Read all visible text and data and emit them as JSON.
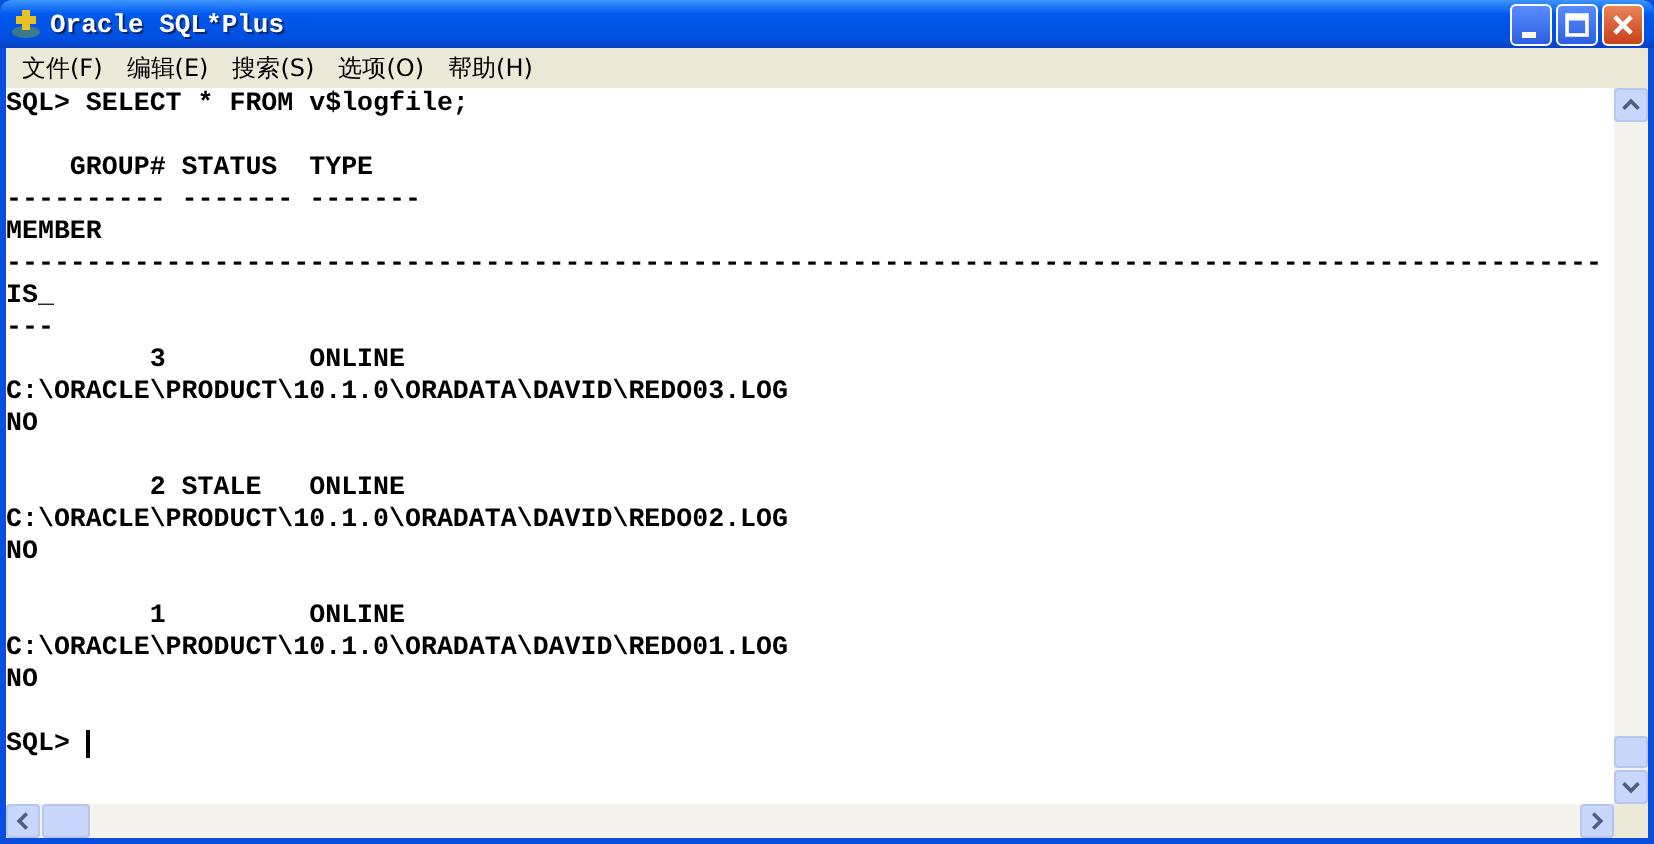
{
  "window": {
    "title": "Oracle SQL*Plus"
  },
  "menu": [
    "文件(F)",
    "编辑(E)",
    "搜索(S)",
    "选项(O)",
    "帮助(H)"
  ],
  "console": {
    "blocks": [
      [
        "SQL> SELECT * FROM v$logfile;"
      ],
      [
        "    GROUP# STATUS  TYPE",
        "---------- ------- -------",
        "MEMBER",
        "----------------------------------------------------------------------------------------------------",
        "IS_",
        "---",
        "         3         ONLINE",
        "C:\\ORACLE\\PRODUCT\\10.1.0\\ORADATA\\DAVID\\REDO03.LOG",
        "NO"
      ],
      [
        "         2 STALE   ONLINE",
        "C:\\ORACLE\\PRODUCT\\10.1.0\\ORADATA\\DAVID\\REDO02.LOG",
        "NO"
      ],
      [
        "         1         ONLINE",
        "C:\\ORACLE\\PRODUCT\\10.1.0\\ORADATA\\DAVID\\REDO01.LOG",
        "NO"
      ]
    ],
    "prompt": "SQL>"
  }
}
